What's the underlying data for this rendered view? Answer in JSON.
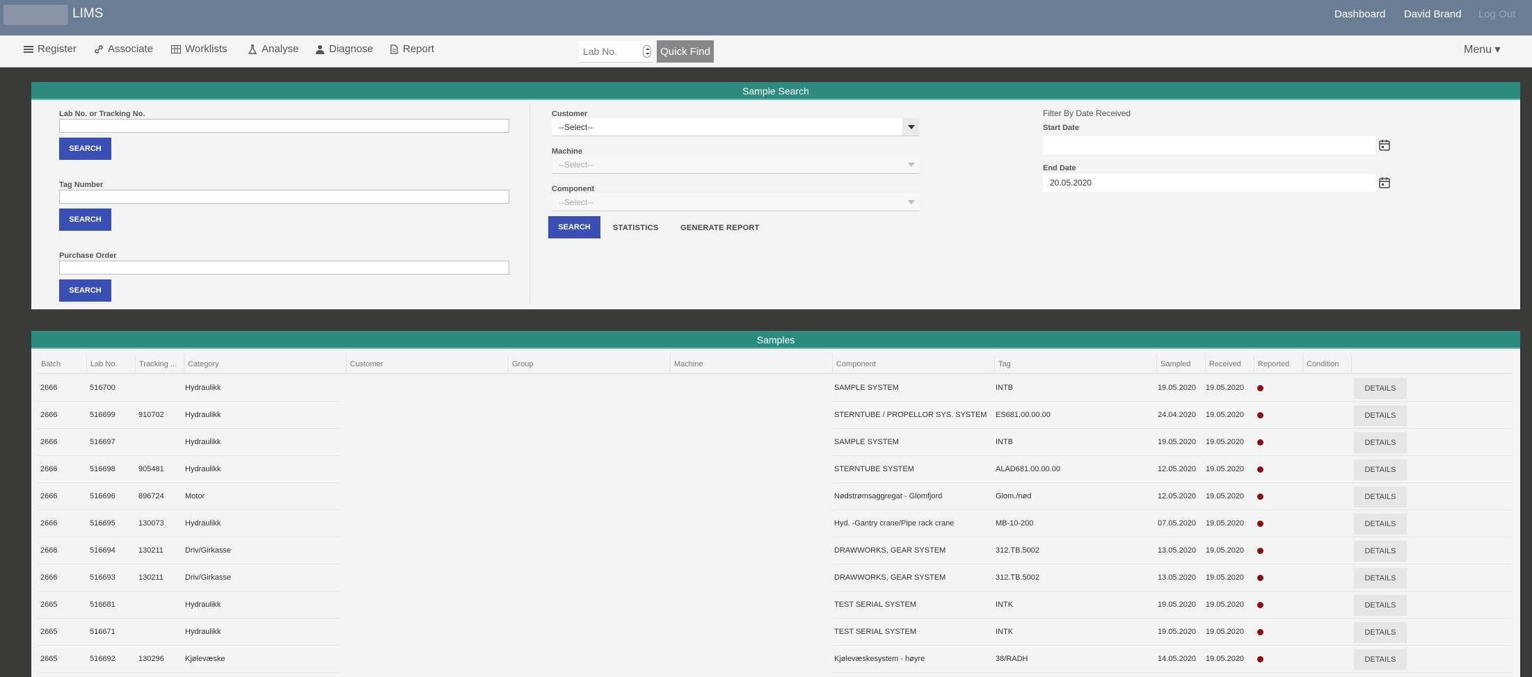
{
  "app": {
    "title": "LIMS"
  },
  "topbar": {
    "dashboard": "Dashboard",
    "user": "David Brand",
    "logout": "Log Out"
  },
  "nav": {
    "items": [
      "Register",
      "Associate",
      "Worklists",
      "Analyse",
      "Diagnose",
      "Report"
    ],
    "labno_placeholder": "Lab No.",
    "quickfind": "Quick Find",
    "menu": "Menu ▾"
  },
  "search_panel": {
    "title": "Sample Search",
    "labno_label": "Lab No. or Tracking No.",
    "tag_label": "Tag Number",
    "po_label": "Purchase Order",
    "search_label": "SEARCH",
    "customer_label": "Customer",
    "customer_value": "--Select--",
    "machine_label": "Machine",
    "machine_value": "--Select--",
    "component_label": "Component",
    "component_value": "--Select--",
    "statistics_label": "STATISTICS",
    "generate_report_label": "GENERATE REPORT",
    "filter_title": "Filter By Date Received",
    "start_label": "Start Date",
    "start_value": "",
    "end_label": "End Date",
    "end_value": "20.05.2020"
  },
  "samples": {
    "title": "Samples",
    "columns": [
      "Batch",
      "Lab No.",
      "Tracking ...",
      "Category",
      "Customer",
      "Group",
      "Machine",
      "Component",
      "Tag",
      "Sampled",
      "Received",
      "Reported",
      "Condition"
    ],
    "details_label": "DETAILS",
    "status_color": "#8b0d0d",
    "rows": [
      {
        "batch": "2666",
        "lab": "516700",
        "tracking": "",
        "category": "Hydraulikk",
        "component": "SAMPLE SYSTEM",
        "tag": "INTB",
        "sampled": "19.05.2020",
        "received": "19.05.2020"
      },
      {
        "batch": "2666",
        "lab": "516699",
        "tracking": "910702",
        "category": "Hydraulikk",
        "component": "STERNTUBE / PROPELLOR SYS. SYSTEM",
        "tag": "ES681.00.00.00",
        "sampled": "24.04.2020",
        "received": "19.05.2020"
      },
      {
        "batch": "2666",
        "lab": "516697",
        "tracking": "",
        "category": "Hydraulikk",
        "component": "SAMPLE SYSTEM",
        "tag": "INTB",
        "sampled": "19.05.2020",
        "received": "19.05.2020"
      },
      {
        "batch": "2666",
        "lab": "516698",
        "tracking": "905481",
        "category": "Hydraulikk",
        "component": "STERNTUBE SYSTEM",
        "tag": "ALAD681.00.00.00",
        "sampled": "12.05.2020",
        "received": "19.05.2020"
      },
      {
        "batch": "2666",
        "lab": "516696",
        "tracking": "896724",
        "category": "Motor",
        "component": "Nødstrømsaggregat - Glomfjord",
        "tag": "Glom./nød",
        "sampled": "12.05.2020",
        "received": "19.05.2020"
      },
      {
        "batch": "2666",
        "lab": "516695",
        "tracking": "130073",
        "category": "Hydraulikk",
        "component": "Hyd. -Gantry crane/Pipe rack crane",
        "tag": "MB-10-200",
        "sampled": "07.05.2020",
        "received": "19.05.2020"
      },
      {
        "batch": "2666",
        "lab": "516694",
        "tracking": "130211",
        "category": "Driv/Girkasse",
        "component": "DRAWWORKS, GEAR SYSTEM",
        "tag": "312.TB.5002",
        "sampled": "13.05.2020",
        "received": "19.05.2020"
      },
      {
        "batch": "2666",
        "lab": "516693",
        "tracking": "130211",
        "category": "Driv/Girkasse",
        "component": "DRAWWORKS, GEAR SYSTEM",
        "tag": "312.TB.5002",
        "sampled": "13.05.2020",
        "received": "19.05.2020"
      },
      {
        "batch": "2665",
        "lab": "516681",
        "tracking": "",
        "category": "Hydraulikk",
        "component": "TEST SERIAL SYSTEM",
        "tag": "INTK",
        "sampled": "19.05.2020",
        "received": "19.05.2020"
      },
      {
        "batch": "2665",
        "lab": "516671",
        "tracking": "",
        "category": "Hydraulikk",
        "component": "TEST SERIAL SYSTEM",
        "tag": "INTK",
        "sampled": "19.05.2020",
        "received": "19.05.2020"
      },
      {
        "batch": "2665",
        "lab": "516692",
        "tracking": "130296",
        "category": "Kjølevæske",
        "component": "Kjølevæskesystem - høyre",
        "tag": "38/RADH",
        "sampled": "14.05.2020",
        "received": "19.05.2020"
      }
    ]
  }
}
